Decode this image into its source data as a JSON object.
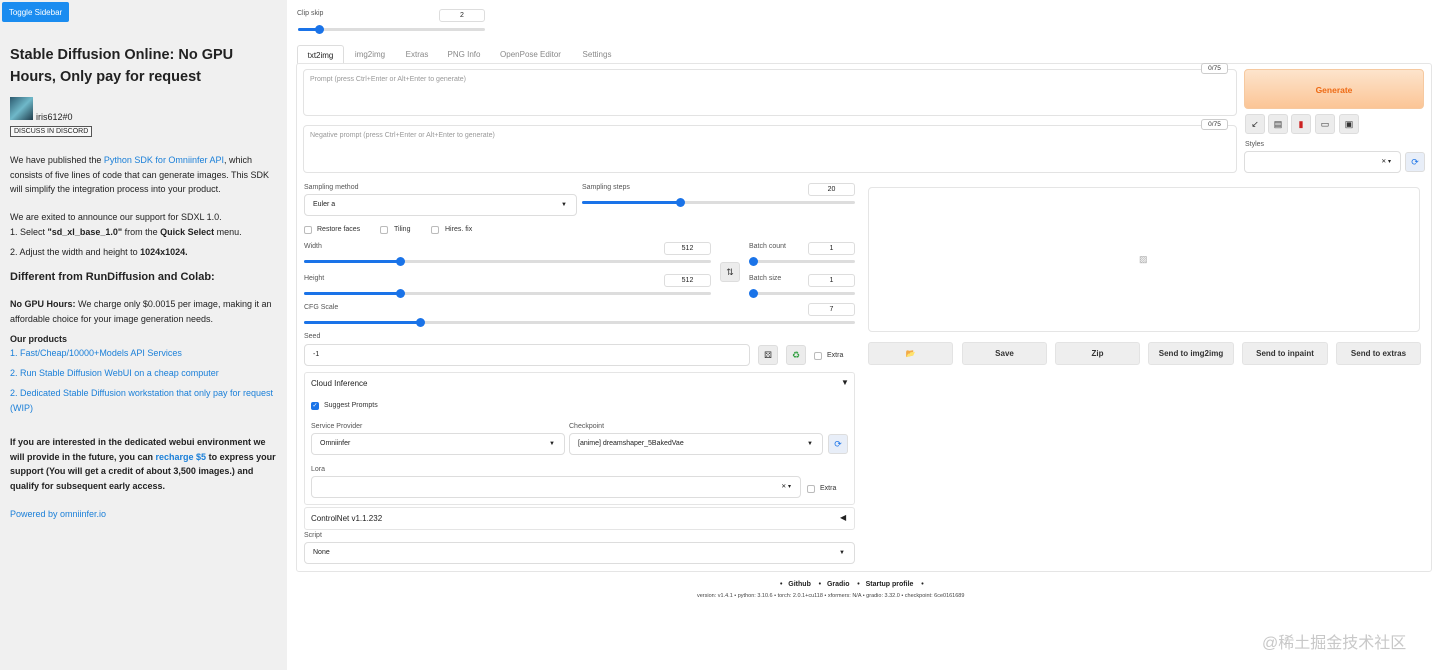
{
  "sidebar": {
    "toggle_label": "Toggle Sidebar",
    "title": "Stable Diffusion Online: No GPU Hours, Only pay for request",
    "username": "iris612#0",
    "discord_label": "DISCUSS IN DISCORD",
    "para1_pre": "We have published the ",
    "para1_link": "Python SDK for Omniinfer API",
    "para1_post": ", which consists of five lines of code that can generate images. This SDK will simplify the integration process into your product.",
    "para2": "We are exited to announce our support for SDXL 1.0.",
    "step1_pre": "1. Select ",
    "step1_bold": "\"sd_xl_base_1.0\"",
    "step1_mid": " from the ",
    "step1_bold2": "Quick Select",
    "step1_post": " menu.",
    "step2_pre": "2. Adjust the width and height to ",
    "step2_bold": "1024x1024.",
    "heading": "Different from RunDiffusion and Colab:",
    "nogpu_bold": "No GPU Hours:",
    "nogpu_text": " We charge only $0.0015 per image, making it an affordable choice for your image generation needs.",
    "products_heading": "Our products",
    "product1": "1. Fast/Cheap/10000+Models API Services",
    "product2": "2. Run Stable Diffusion WebUI on a cheap computer",
    "product3": "2. Dedicated Stable Diffusion workstation that only pay for request (WIP)",
    "interest_pre": "If you are interested in the dedicated webui environment we will provide in the future, you can ",
    "interest_link": "recharge $5",
    "interest_post": " to express your support (You will get a credit of about 3,500 images.) and qualify for subsequent early access.",
    "powered": "Powered by omniinfer.io"
  },
  "clip_skip": {
    "label": "Clip skip",
    "value": "2",
    "fraction": 0.11
  },
  "tabs": [
    {
      "label": "txt2img"
    },
    {
      "label": "img2img"
    },
    {
      "label": "Extras"
    },
    {
      "label": "PNG Info"
    },
    {
      "label": "OpenPose Editor"
    },
    {
      "label": "Settings"
    }
  ],
  "prompt": {
    "placeholder": "Prompt (press Ctrl+Enter or Alt+Enter to generate)",
    "counter": "0/75"
  },
  "negative_prompt": {
    "placeholder": "Negative prompt (press Ctrl+Enter or Alt+Enter to generate)",
    "counter": "0/75"
  },
  "generate_label": "Generate",
  "tool_icons": [
    "arrow-icon",
    "trash-icon",
    "card-icon",
    "clipboard-icon",
    "save-icon"
  ],
  "styles_label": "Styles",
  "sampling_method": {
    "label": "Sampling method",
    "value": "Euler a"
  },
  "sampling_steps": {
    "label": "Sampling steps",
    "value": "20",
    "fraction": 0.36
  },
  "options": {
    "restore_faces": "Restore faces",
    "tiling": "Tiling",
    "hires_fix": "Hires. fix"
  },
  "width": {
    "label": "Width",
    "value": "512",
    "fraction": 0.235
  },
  "height": {
    "label": "Height",
    "value": "512",
    "fraction": 0.235
  },
  "batch_count": {
    "label": "Batch count",
    "value": "1",
    "fraction": 0.0
  },
  "batch_size": {
    "label": "Batch size",
    "value": "1",
    "fraction": 0.0
  },
  "cfg_scale": {
    "label": "CFG Scale",
    "value": "7",
    "fraction": 0.21
  },
  "seed": {
    "label": "Seed",
    "value": "-1",
    "extra_label": "Extra"
  },
  "cloud_inference": {
    "title": "Cloud Inference",
    "suggest_prompts": "Suggest Prompts",
    "service_provider_label": "Service Provider",
    "service_provider_value": "Omniinfer",
    "checkpoint_label": "Checkpoint",
    "checkpoint_value": "[anime] dreamshaper_5BakedVae",
    "lora_label": "Lora",
    "lora_extra": "Extra"
  },
  "controlnet_title": "ControlNet v1.1.232",
  "script": {
    "label": "Script",
    "value": "None"
  },
  "actions": {
    "save": "Save",
    "zip": "Zip",
    "send_img2img": "Send to img2img",
    "send_inpaint": "Send to inpaint",
    "send_extras": "Send to extras"
  },
  "footer": {
    "links": [
      "Github",
      "Gradio",
      "Startup profile"
    ],
    "version": "version: v1.4.1  •  python: 3.10.6  •  torch: 2.0.1+cu118  •  xformers: N/A  •  gradio: 3.32.0  •  checkpoint: 6ce0161689"
  },
  "watermark": "@稀土掘金技术社区",
  "colors": {
    "accent": "#1a73e8",
    "generate": "#ee6a14",
    "link": "#1a7fd8"
  }
}
